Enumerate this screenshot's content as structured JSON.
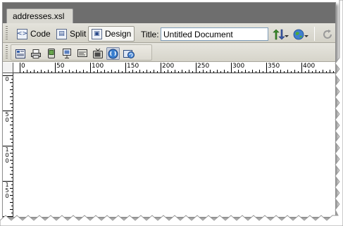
{
  "document_tab": {
    "label": "addresses.xsl"
  },
  "toolbar": {
    "views": [
      {
        "label": "Code",
        "icon": "code-view-icon"
      },
      {
        "label": "Split",
        "icon": "split-view-icon"
      },
      {
        "label": "Design",
        "icon": "design-view-icon",
        "active": true
      }
    ],
    "title_label": "Title:",
    "title_value": "Untitled Document",
    "icons": [
      "file-management-icon",
      "preview-browser-icon",
      "refresh-icon"
    ]
  },
  "toolbar2": {
    "icons": [
      "layout-table-icon",
      "print-icon",
      "handheld-icon",
      "projection-icon",
      "screen-icon",
      "tv-icon",
      "css-styles-icon",
      "css-refresh-icon"
    ]
  },
  "ruler": {
    "horizontal_labels": [
      "0",
      "50",
      "100",
      "150",
      "200",
      "250",
      "300",
      "350",
      "400"
    ],
    "vertical_labels": [
      "0",
      "50",
      "100",
      "150"
    ]
  },
  "colors": {
    "tabstrip": "#6e6e6e",
    "toolbar": "#d9d8d1",
    "accent": "#2a4a8a"
  }
}
